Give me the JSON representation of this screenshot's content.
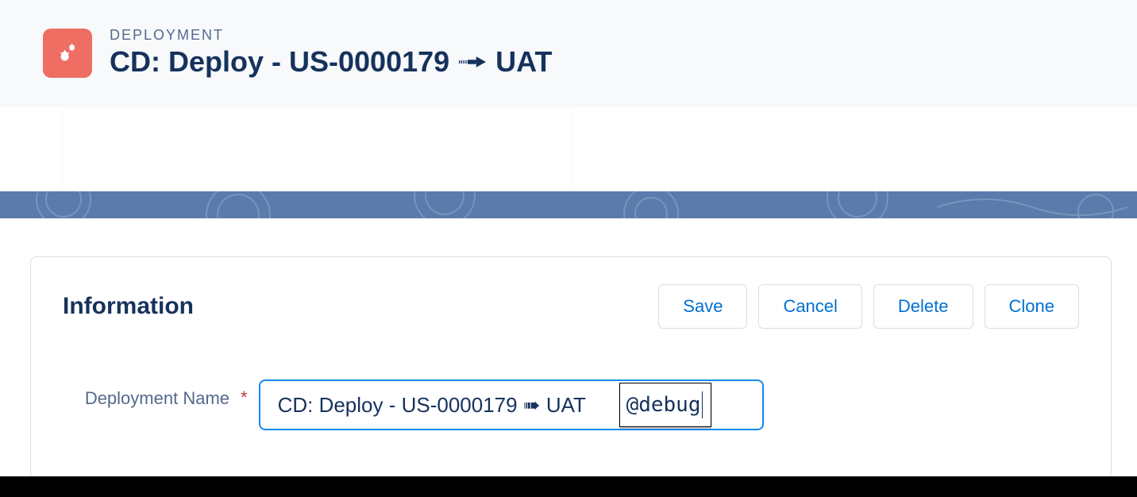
{
  "header": {
    "eyebrow": "DEPLOYMENT",
    "title_prefix": "CD: Deploy - US-0000179",
    "title_suffix": "UAT"
  },
  "card": {
    "section_title": "Information",
    "buttons": {
      "save": "Save",
      "cancel": "Cancel",
      "delete": "Delete",
      "clone": "Clone"
    },
    "fields": {
      "deployment_name": {
        "label": "Deployment Name",
        "required_marker": "*",
        "value": "CD: Deploy - US-0000179 ➠ UAT",
        "suggest": "@debug"
      }
    }
  }
}
